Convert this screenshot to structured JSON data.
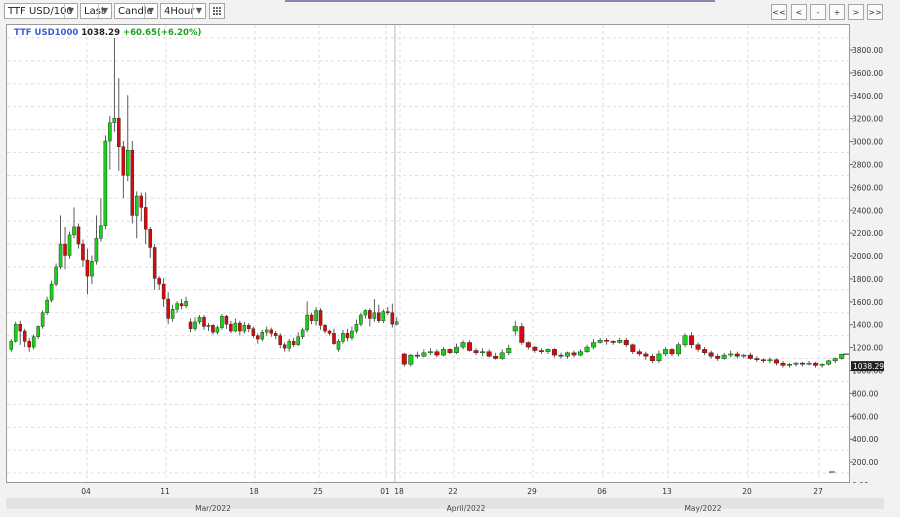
{
  "toolbar": {
    "symbol": "TTF USD/100",
    "price_type": "Last",
    "chart_style": "Candle",
    "interval": "4Hour",
    "nav": [
      "<<",
      "<",
      "-",
      "+",
      ">",
      ">>"
    ]
  },
  "legend": {
    "symbol": "TTF USD1000",
    "last": "1038.29",
    "change": "+60.65(+6.20%)"
  },
  "colors": {
    "up": "#17d117",
    "down": "#d50b0b",
    "wick": "#333333",
    "grid": "#dddddd"
  },
  "chart_data": {
    "type": "candlestick",
    "y_ticks": [
      "3800.00",
      "3600.00",
      "3400.00",
      "3200.00",
      "3000.00",
      "2800.00",
      "2600.00",
      "2400.00",
      "2200.00",
      "2000.00",
      "1800.00",
      "1600.00",
      "1400.00",
      "1200.00",
      "1000.00",
      "800.00",
      "600.00",
      "400.00",
      "200.00",
      "0.00"
    ],
    "ylim": [
      0,
      3800
    ],
    "last_price_label": "1038.29",
    "x_tick_labels": [
      "04",
      "11",
      "18",
      "25",
      "01",
      "18",
      "22",
      "29",
      "06",
      "13",
      "20",
      "27"
    ],
    "months": [
      "Mar/2022",
      "April/2022",
      "May/2022"
    ],
    "grid": true,
    "candles": [
      [
        1080,
        1150,
        1060,
        1170
      ],
      [
        1150,
        1300,
        1140,
        1320
      ],
      [
        1300,
        1240,
        1120,
        1330
      ],
      [
        1240,
        1150,
        1100,
        1260
      ],
      [
        1150,
        1100,
        1060,
        1180
      ],
      [
        1100,
        1190,
        1080,
        1210
      ],
      [
        1190,
        1280,
        1170,
        1290
      ],
      [
        1280,
        1400,
        1260,
        1420
      ],
      [
        1400,
        1510,
        1380,
        1540
      ],
      [
        1510,
        1650,
        1490,
        1680
      ],
      [
        1650,
        1800,
        1630,
        1830
      ],
      [
        1800,
        2000,
        1780,
        2250
      ],
      [
        2000,
        1900,
        1780,
        2150
      ],
      [
        1900,
        2080,
        1870,
        2110
      ],
      [
        2080,
        2150,
        2050,
        2320
      ],
      [
        2150,
        2000,
        1960,
        2180
      ],
      [
        2000,
        1860,
        1800,
        2040
      ],
      [
        1860,
        1720,
        1560,
        1960
      ],
      [
        1720,
        1850,
        1650,
        1900
      ],
      [
        1850,
        2050,
        1820,
        2250
      ],
      [
        2050,
        2160,
        2020,
        2400
      ],
      [
        2160,
        2900,
        2130,
        2950
      ],
      [
        2900,
        3060,
        2650,
        3120
      ],
      [
        3060,
        3100,
        2980,
        3800
      ],
      [
        3100,
        2850,
        2640,
        3450
      ],
      [
        2850,
        2600,
        2400,
        2900
      ],
      [
        2600,
        2820,
        2550,
        3300
      ],
      [
        2820,
        2250,
        2180,
        2900
      ],
      [
        2250,
        2420,
        2050,
        2460
      ],
      [
        2420,
        2320,
        2200,
        2450
      ],
      [
        2320,
        2130,
        2000,
        2450
      ],
      [
        2130,
        1970,
        1880,
        2150
      ],
      [
        1970,
        1700,
        1600,
        2000
      ],
      [
        1700,
        1650,
        1600,
        1720
      ],
      [
        1650,
        1520,
        1450,
        1700
      ],
      [
        1520,
        1350,
        1300,
        1580
      ],
      [
        1350,
        1430,
        1320,
        1470
      ],
      [
        1430,
        1480,
        1400,
        1500
      ],
      [
        1480,
        1460,
        1430,
        1520
      ],
      [
        1460,
        1500,
        1440,
        1540
      ],
      [
        1320,
        1260,
        1230,
        1350
      ],
      [
        1260,
        1320,
        1240,
        1360
      ],
      [
        1320,
        1360,
        1300,
        1380
      ],
      [
        1360,
        1280,
        1250,
        1380
      ],
      [
        1280,
        1290,
        1240,
        1310
      ],
      [
        1290,
        1230,
        1210,
        1300
      ],
      [
        1230,
        1270,
        1210,
        1290
      ],
      [
        1270,
        1370,
        1250,
        1390
      ],
      [
        1370,
        1300,
        1260,
        1380
      ],
      [
        1300,
        1240,
        1220,
        1330
      ],
      [
        1240,
        1310,
        1230,
        1350
      ],
      [
        1310,
        1240,
        1200,
        1330
      ],
      [
        1240,
        1290,
        1220,
        1320
      ],
      [
        1290,
        1260,
        1230,
        1310
      ],
      [
        1260,
        1200,
        1180,
        1280
      ],
      [
        1200,
        1170,
        1130,
        1220
      ],
      [
        1170,
        1230,
        1150,
        1250
      ],
      [
        1230,
        1250,
        1200,
        1280
      ],
      [
        1250,
        1220,
        1190,
        1270
      ],
      [
        1220,
        1200,
        1170,
        1240
      ],
      [
        1200,
        1120,
        1090,
        1220
      ],
      [
        1120,
        1090,
        1060,
        1140
      ],
      [
        1090,
        1150,
        1060,
        1170
      ],
      [
        1150,
        1120,
        1100,
        1180
      ],
      [
        1120,
        1190,
        1110,
        1230
      ],
      [
        1190,
        1250,
        1170,
        1270
      ],
      [
        1250,
        1380,
        1230,
        1500
      ],
      [
        1380,
        1330,
        1300,
        1400
      ],
      [
        1330,
        1420,
        1290,
        1450
      ],
      [
        1420,
        1290,
        1250,
        1440
      ],
      [
        1290,
        1240,
        1220,
        1300
      ],
      [
        1240,
        1220,
        1200,
        1250
      ],
      [
        1220,
        1130,
        1120,
        1260
      ],
      [
        1080,
        1150,
        1060,
        1170
      ],
      [
        1150,
        1220,
        1130,
        1250
      ],
      [
        1220,
        1180,
        1150,
        1260
      ],
      [
        1180,
        1240,
        1160,
        1280
      ],
      [
        1240,
        1300,
        1220,
        1340
      ],
      [
        1300,
        1380,
        1280,
        1400
      ],
      [
        1380,
        1420,
        1350,
        1430
      ],
      [
        1420,
        1350,
        1280,
        1440
      ],
      [
        1350,
        1400,
        1320,
        1520
      ],
      [
        1400,
        1330,
        1310,
        1470
      ],
      [
        1330,
        1410,
        1310,
        1430
      ],
      [
        1410,
        1400,
        1380,
        1450
      ],
      [
        1400,
        1300,
        1270,
        1480
      ],
      [
        1300,
        1320,
        1290,
        1360
      ],
      [
        1040,
        950,
        930,
        1050
      ],
      [
        950,
        1030,
        930,
        1040
      ],
      [
        1030,
        1020,
        1000,
        1060
      ],
      [
        1020,
        1050,
        1010,
        1080
      ],
      [
        1050,
        1060,
        1030,
        1090
      ],
      [
        1060,
        1030,
        1010,
        1080
      ],
      [
        1030,
        1080,
        1020,
        1100
      ],
      [
        1080,
        1050,
        1040,
        1090
      ],
      [
        1050,
        1100,
        1040,
        1130
      ],
      [
        1100,
        1140,
        1080,
        1160
      ],
      [
        1140,
        1070,
        1060,
        1160
      ],
      [
        1070,
        1050,
        1030,
        1090
      ],
      [
        1050,
        1060,
        1020,
        1090
      ],
      [
        1060,
        1020,
        1010,
        1080
      ],
      [
        1020,
        1000,
        990,
        1050
      ],
      [
        1000,
        1050,
        990,
        1080
      ],
      [
        1050,
        1090,
        1030,
        1120
      ],
      [
        1240,
        1280,
        1200,
        1330
      ],
      [
        1280,
        1140,
        1120,
        1310
      ],
      [
        1140,
        1100,
        1080,
        1150
      ],
      [
        1100,
        1070,
        1050,
        1110
      ],
      [
        1070,
        1060,
        1040,
        1090
      ],
      [
        1060,
        1080,
        1040,
        1090
      ],
      [
        1080,
        1030,
        1010,
        1090
      ],
      [
        1030,
        1020,
        1000,
        1050
      ],
      [
        1020,
        1050,
        1000,
        1060
      ],
      [
        1050,
        1030,
        1010,
        1070
      ],
      [
        1030,
        1060,
        1020,
        1080
      ],
      [
        1060,
        1100,
        1050,
        1120
      ],
      [
        1100,
        1140,
        1080,
        1170
      ],
      [
        1140,
        1160,
        1130,
        1180
      ],
      [
        1160,
        1150,
        1120,
        1180
      ],
      [
        1150,
        1140,
        1120,
        1160
      ],
      [
        1140,
        1160,
        1130,
        1180
      ],
      [
        1160,
        1120,
        1100,
        1180
      ],
      [
        1120,
        1060,
        1040,
        1130
      ],
      [
        1060,
        1040,
        1020,
        1080
      ],
      [
        1040,
        1020,
        990,
        1060
      ],
      [
        1020,
        980,
        960,
        1040
      ],
      [
        980,
        1040,
        960,
        1070
      ],
      [
        1040,
        1080,
        1020,
        1100
      ],
      [
        1080,
        1040,
        1020,
        1090
      ],
      [
        1040,
        1120,
        1020,
        1140
      ],
      [
        1120,
        1200,
        1100,
        1220
      ],
      [
        1200,
        1120,
        1090,
        1230
      ],
      [
        1120,
        1080,
        1060,
        1140
      ],
      [
        1080,
        1050,
        1030,
        1100
      ],
      [
        1050,
        1020,
        1000,
        1070
      ],
      [
        1020,
        1000,
        980,
        1040
      ],
      [
        1000,
        1030,
        990,
        1050
      ],
      [
        1030,
        1040,
        1010,
        1070
      ],
      [
        1040,
        1020,
        1000,
        1060
      ],
      [
        1020,
        1030,
        1000,
        1040
      ],
      [
        1030,
        1000,
        990,
        1050
      ],
      [
        1000,
        990,
        970,
        1020
      ],
      [
        990,
        980,
        960,
        1000
      ],
      [
        980,
        990,
        960,
        1010
      ],
      [
        990,
        960,
        940,
        1000
      ],
      [
        960,
        940,
        920,
        980
      ],
      [
        940,
        950,
        920,
        960
      ],
      [
        950,
        960,
        930,
        970
      ],
      [
        960,
        950,
        930,
        970
      ],
      [
        950,
        960,
        940,
        980
      ],
      [
        960,
        940,
        920,
        970
      ],
      [
        940,
        950,
        920,
        960
      ],
      [
        950,
        980,
        940,
        990
      ],
      [
        980,
        1000,
        960,
        1010
      ],
      [
        1000,
        1038,
        990,
        1040
      ]
    ]
  }
}
